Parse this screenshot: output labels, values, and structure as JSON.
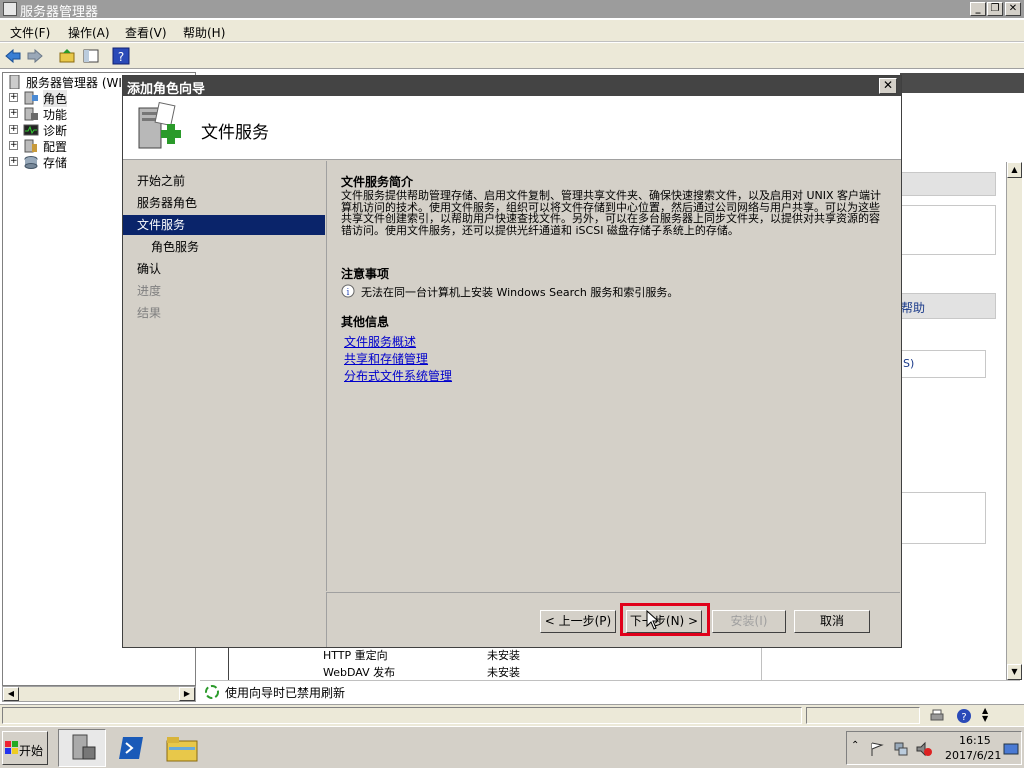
{
  "window": {
    "title": "服务器管理器"
  },
  "menu": [
    "文件(F)",
    "操作(A)",
    "查看(V)",
    "帮助(H)"
  ],
  "tree": {
    "root": "服务器管理器 (WI",
    "items": [
      "角色",
      "功能",
      "诊断",
      "配置",
      "存储"
    ]
  },
  "right": {
    "link_fragment": "帮助",
    "value_fragment": "S)",
    "rows": [
      {
        "name": "HTTP 重定向",
        "status": "未安装"
      },
      {
        "name": "WebDAV 发布",
        "status": "未安装"
      }
    ],
    "refresh_status": "使用向导时已禁用刷新"
  },
  "dialog": {
    "title": "添加角色向导",
    "close": "✕",
    "header": "文件服务",
    "nav": [
      {
        "label": "开始之前",
        "state": "normal"
      },
      {
        "label": "服务器角色",
        "state": "normal"
      },
      {
        "label": "文件服务",
        "state": "selected"
      },
      {
        "label": "角色服务",
        "state": "sub"
      },
      {
        "label": "确认",
        "state": "normal"
      },
      {
        "label": "进度",
        "state": "dim"
      },
      {
        "label": "结果",
        "state": "dim"
      }
    ],
    "intro_title": "文件服务简介",
    "intro_body": "文件服务提供帮助管理存储、启用文件复制、管理共享文件夹、确保快速搜索文件，以及启用对 UNIX 客户端计算机访问的技术。使用文件服务，组织可以将文件存储到中心位置，然后通过公司网络与用户共享。可以为这些共享文件创建索引，以帮助用户快速查找文件。另外，可以在多台服务器上同步文件夹，以提供对共享资源的容错访问。使用文件服务，还可以提供光纤通道和 iSCSI 磁盘存储子系统上的存储。",
    "notes_title": "注意事项",
    "note": "无法在同一台计算机上安装 Windows Search 服务和索引服务。",
    "more_title": "其他信息",
    "links": [
      "文件服务概述",
      "共享和存储管理",
      "分布式文件系统管理"
    ],
    "buttons": {
      "prev": "< 上一步(P)",
      "next": "下一步(N) >",
      "install": "安装(I)",
      "cancel": "取消"
    }
  },
  "taskbar": {
    "start": "开始",
    "time": "16:15",
    "date": "2017/6/21"
  }
}
